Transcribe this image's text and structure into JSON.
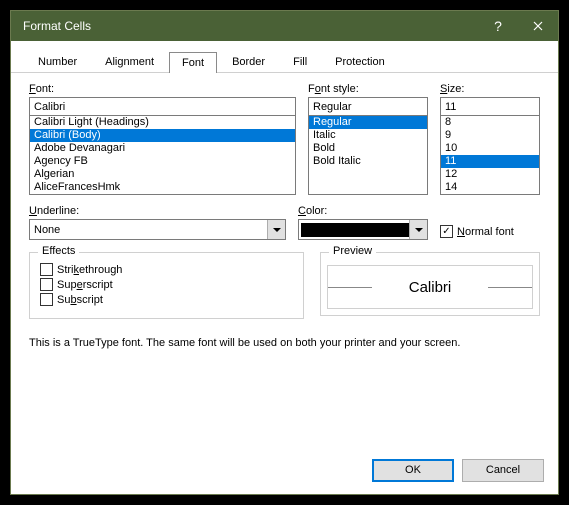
{
  "title": "Format Cells",
  "tabs": [
    "Number",
    "Alignment",
    "Font",
    "Border",
    "Fill",
    "Protection"
  ],
  "active_tab": "Font",
  "font": {
    "label": "Font:",
    "value": "Calibri",
    "items": [
      "Calibri Light (Headings)",
      "Calibri (Body)",
      "Adobe Devanagari",
      "Agency FB",
      "Algerian",
      "AliceFrancesHmk"
    ],
    "selected": "Calibri (Body)"
  },
  "style": {
    "label": "Font style:",
    "value": "Regular",
    "items": [
      "Regular",
      "Italic",
      "Bold",
      "Bold Italic"
    ],
    "selected": "Regular"
  },
  "size": {
    "label": "Size:",
    "value": "11",
    "items": [
      "8",
      "9",
      "10",
      "11",
      "12",
      "14"
    ],
    "selected": "11"
  },
  "underline": {
    "label": "Underline:",
    "value": "None"
  },
  "color": {
    "label": "Color:",
    "value": "#000000"
  },
  "normal_font": {
    "label": "Normal font",
    "checked": true
  },
  "effects": {
    "legend": "Effects",
    "strike": {
      "label": "Strikethrough",
      "checked": false
    },
    "super": {
      "label": "Superscript",
      "checked": false
    },
    "sub": {
      "label": "Subscript",
      "checked": false
    }
  },
  "preview": {
    "legend": "Preview",
    "text": "Calibri"
  },
  "footnote": "This is a TrueType font.  The same font will be used on both your printer and your screen.",
  "buttons": {
    "ok": "OK",
    "cancel": "Cancel"
  }
}
